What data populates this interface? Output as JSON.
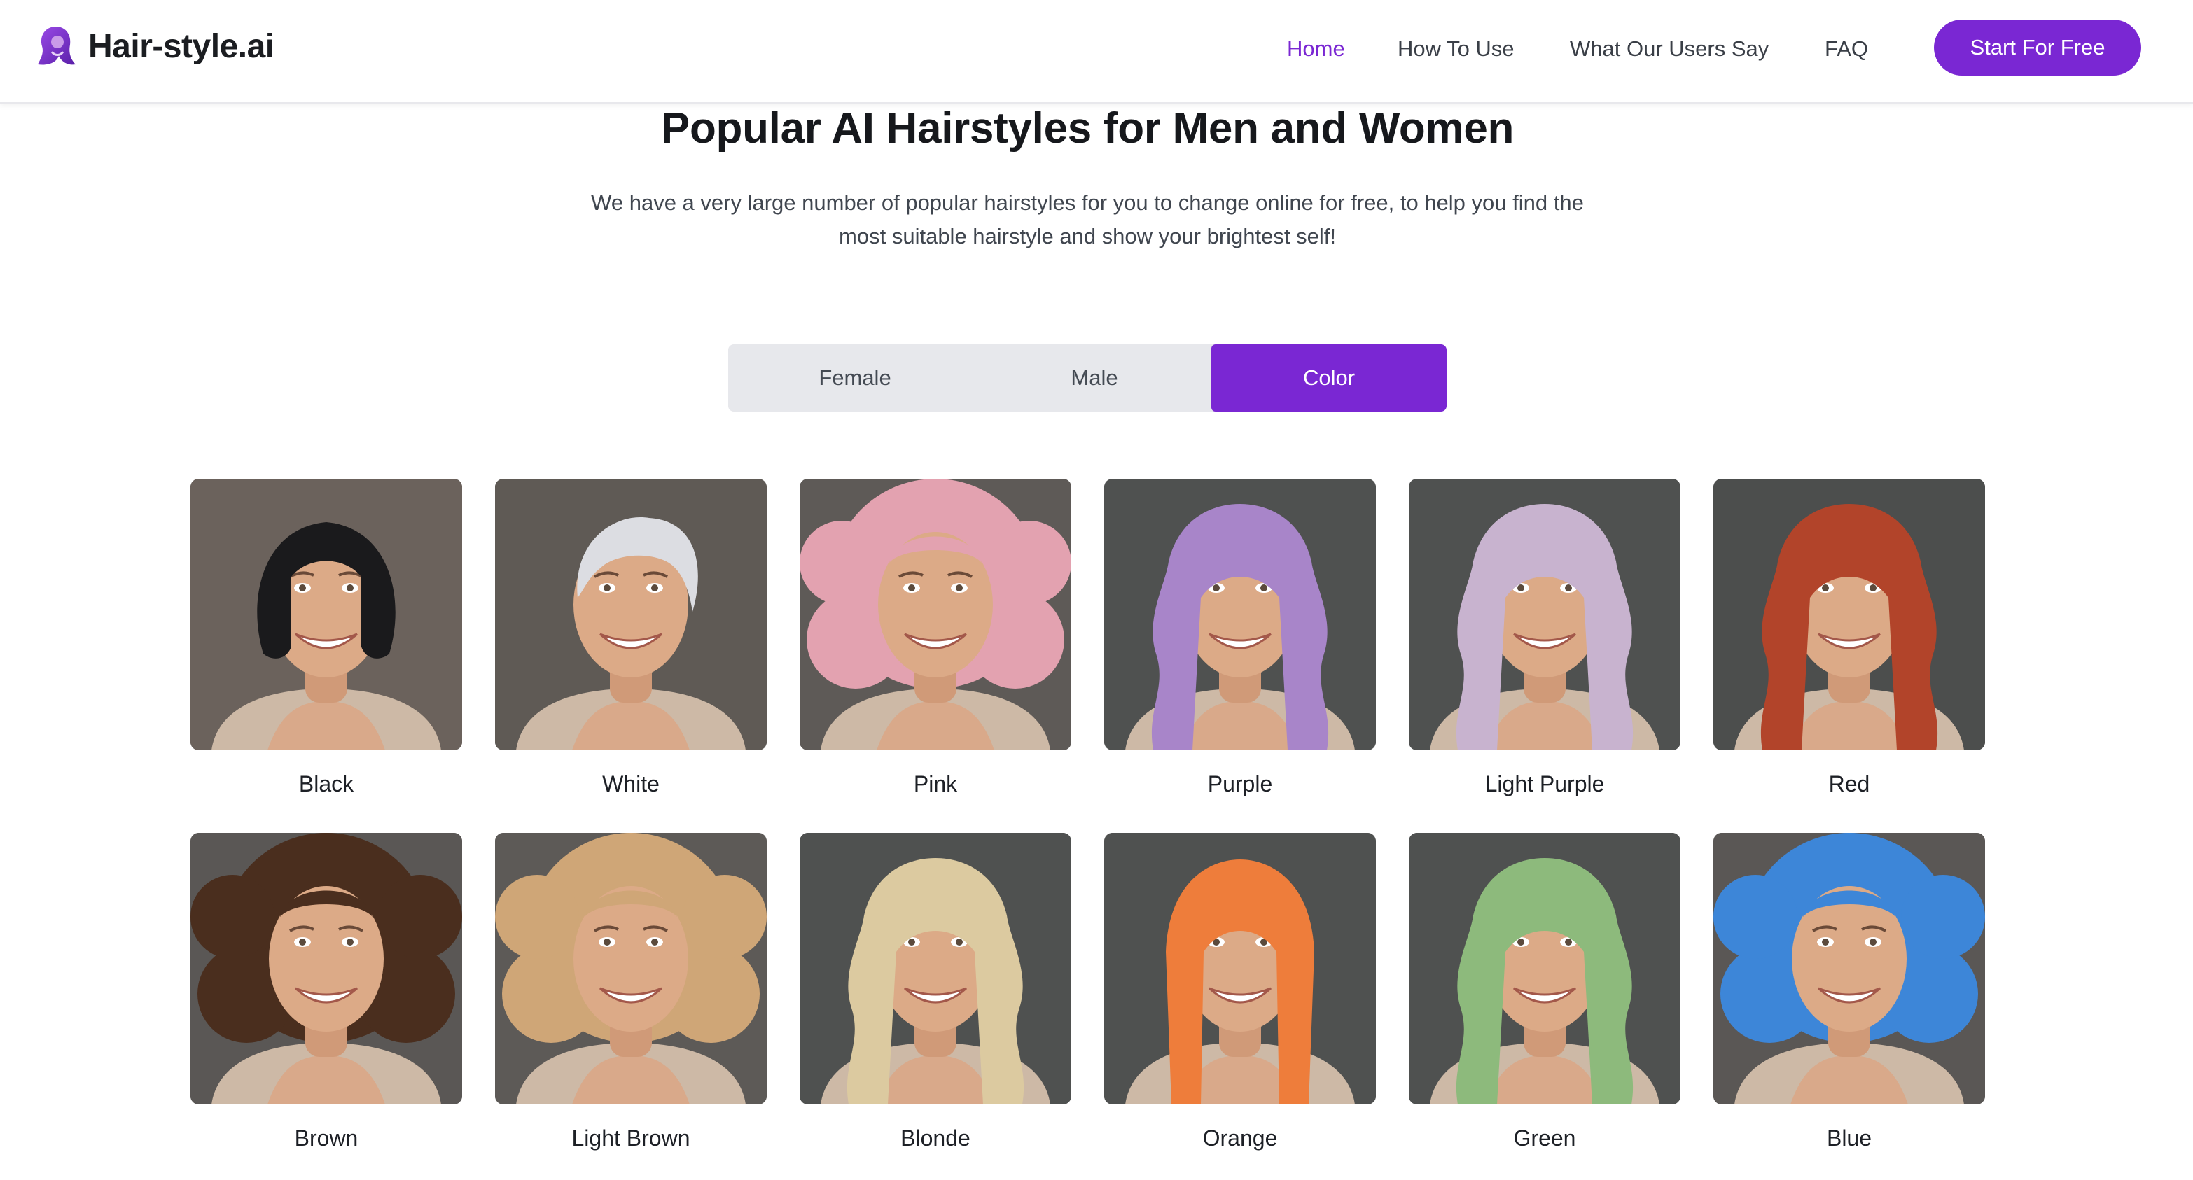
{
  "header": {
    "brand": "Hair-style.ai",
    "nav": [
      {
        "label": "Home",
        "active": true
      },
      {
        "label": "How To Use",
        "active": false
      },
      {
        "label": "What Our Users Say",
        "active": false
      },
      {
        "label": "FAQ",
        "active": false
      }
    ],
    "cta_label": "Start For Free"
  },
  "hero": {
    "title": "Popular AI Hairstyles for Men and Women",
    "subtitle_line1": "We have a very large number of popular hairstyles for you to change online for free, to help you find the",
    "subtitle_line2": "most suitable hairstyle and show your brightest self!"
  },
  "tabs": [
    {
      "label": "Female",
      "active": false
    },
    {
      "label": "Male",
      "active": false
    },
    {
      "label": "Color",
      "active": true
    }
  ],
  "colors": {
    "accent": "#7a27d3",
    "nav_text": "#3a3f47",
    "tab_bg": "#e7e8ec"
  },
  "styles": [
    {
      "label": "Black",
      "hair": "#1a1a1c",
      "bg": "#6b625c",
      "shape": "bob"
    },
    {
      "label": "White",
      "hair": "#dcdde2",
      "bg": "#5f5a55",
      "shape": "pixie"
    },
    {
      "label": "Pink",
      "hair": "#e3a2b0",
      "bg": "#5e5a57",
      "shape": "afro"
    },
    {
      "label": "Purple",
      "hair": "#a885c9",
      "bg": "#4f5150",
      "shape": "long"
    },
    {
      "label": "Light Purple",
      "hair": "#c8b3cf",
      "bg": "#4f5150",
      "shape": "long"
    },
    {
      "label": "Red",
      "hair": "#b2442a",
      "bg": "#4c4e4d",
      "shape": "long"
    },
    {
      "label": "Brown",
      "hair": "#4a2e1e",
      "bg": "#5a5755",
      "shape": "afro"
    },
    {
      "label": "Light Brown",
      "hair": "#cfa677",
      "bg": "#5d5a57",
      "shape": "afro"
    },
    {
      "label": "Blonde",
      "hair": "#dccaa0",
      "bg": "#4f5150",
      "shape": "long"
    },
    {
      "label": "Orange",
      "hair": "#ee7d3b",
      "bg": "#4f5150",
      "shape": "straight"
    },
    {
      "label": "Green",
      "hair": "#8dba7c",
      "bg": "#4f5150",
      "shape": "long"
    },
    {
      "label": "Blue",
      "hair": "#3d86d8",
      "bg": "#5a5755",
      "shape": "afro"
    }
  ]
}
